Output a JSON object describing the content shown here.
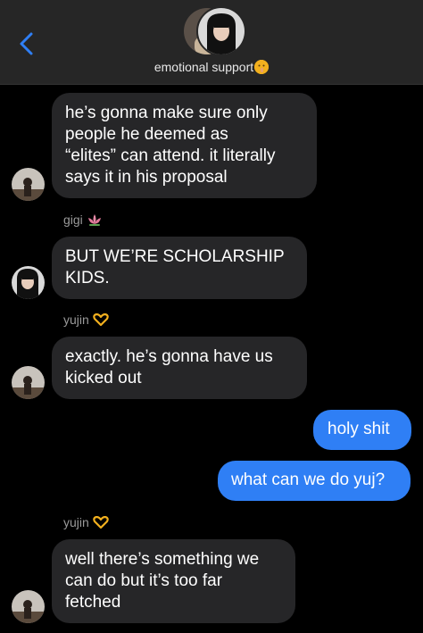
{
  "header": {
    "group_name": "emotional support",
    "colors": {
      "background": "#262626",
      "accent": "#2f7ff5"
    }
  },
  "messages": [
    {
      "type": "in",
      "lines": [
        "he’s gonna make sure only",
        "people he deemed as",
        "“elites” can attend. it literally",
        "says it in his proposal"
      ]
    },
    {
      "type": "sender",
      "name": "gigi",
      "emoji": "lotus-icon"
    },
    {
      "type": "in",
      "lines": [
        "BUT WE’RE SCHOLARSHIP",
        "KIDS."
      ]
    },
    {
      "type": "sender",
      "name": "yujin",
      "emoji": "heart-hands-icon"
    },
    {
      "type": "in",
      "lines": [
        "exactly. he’s gonna have us",
        "kicked out"
      ]
    },
    {
      "type": "out",
      "lines": [
        "holy shit"
      ]
    },
    {
      "type": "out",
      "lines": [
        "what can we do yuj?"
      ]
    },
    {
      "type": "sender",
      "name": "yujin",
      "emoji": "heart-hands-icon"
    },
    {
      "type": "in",
      "lines": [
        "well there’s something we",
        "can do but it’s too far",
        "fetched"
      ]
    }
  ]
}
